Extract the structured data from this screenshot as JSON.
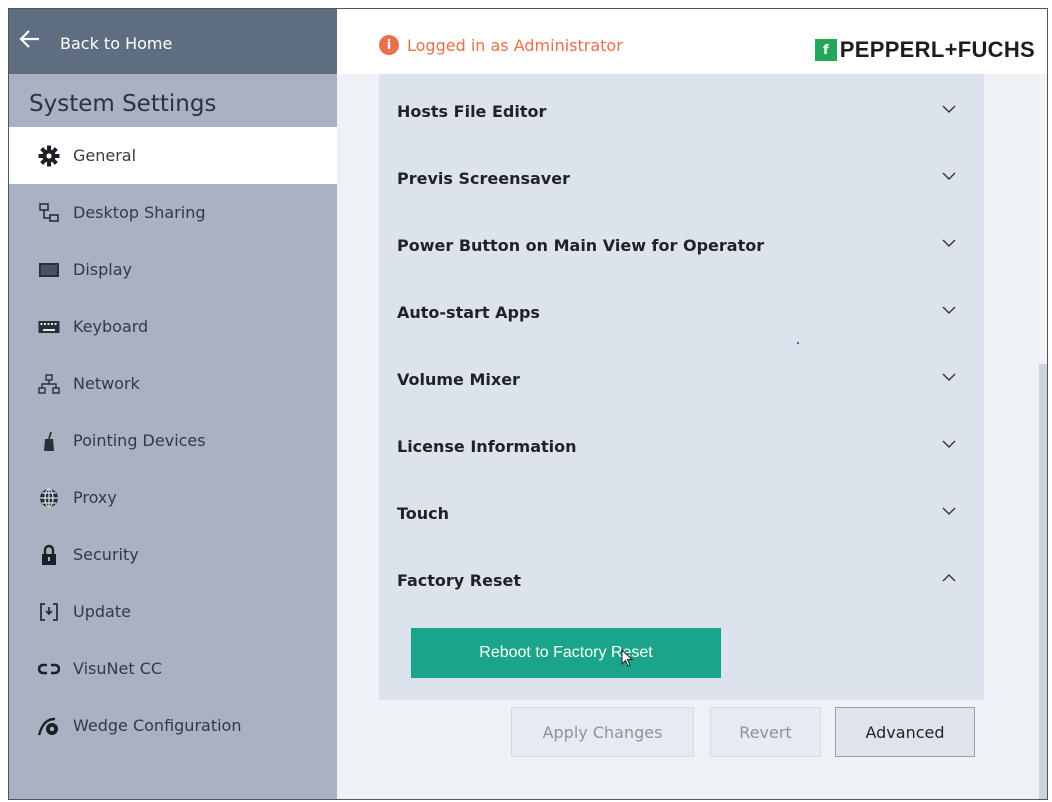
{
  "sidebar": {
    "back_label": "Back to Home",
    "section_title": "System Settings",
    "items": [
      {
        "label": "General",
        "icon": "gear-icon",
        "active": true
      },
      {
        "label": "Desktop Sharing",
        "icon": "desktop-sharing-icon"
      },
      {
        "label": "Display",
        "icon": "monitor-icon"
      },
      {
        "label": "Keyboard",
        "icon": "keyboard-icon"
      },
      {
        "label": "Network",
        "icon": "network-icon"
      },
      {
        "label": "Pointing Devices",
        "icon": "pointing-device-icon"
      },
      {
        "label": "Proxy",
        "icon": "globe-icon"
      },
      {
        "label": "Security",
        "icon": "lock-icon"
      },
      {
        "label": "Update",
        "icon": "update-icon"
      },
      {
        "label": "VisuNet CC",
        "icon": "link-icon"
      },
      {
        "label": "Wedge Configuration",
        "icon": "wedge-gear-icon"
      }
    ]
  },
  "header": {
    "admin_status": "Logged in as Administrator",
    "brand": "PEPPERL+FUCHS",
    "brand_mark": "f"
  },
  "panel": {
    "sections": [
      {
        "title": "Hosts File Editor",
        "expanded": false
      },
      {
        "title": "Previs Screensaver",
        "expanded": false
      },
      {
        "title": "Power Button on Main View for Operator",
        "expanded": false
      },
      {
        "title": "Auto-start Apps",
        "expanded": false
      },
      {
        "title": "Volume Mixer",
        "expanded": false
      },
      {
        "title": "License Information",
        "expanded": false
      },
      {
        "title": "Touch",
        "expanded": false
      },
      {
        "title": "Factory Reset",
        "expanded": true
      }
    ],
    "factory_reset_button": "Reboot to Factory Reset"
  },
  "footer": {
    "apply_label": "Apply Changes",
    "revert_label": "Revert",
    "advanced_label": "Advanced"
  },
  "colors": {
    "sidebar_bg": "#a8b2c3",
    "back_bar_bg": "#5f6d80",
    "accent_green": "#1aa58b",
    "admin_orange": "#e8704a",
    "brand_green": "#23a85a"
  }
}
